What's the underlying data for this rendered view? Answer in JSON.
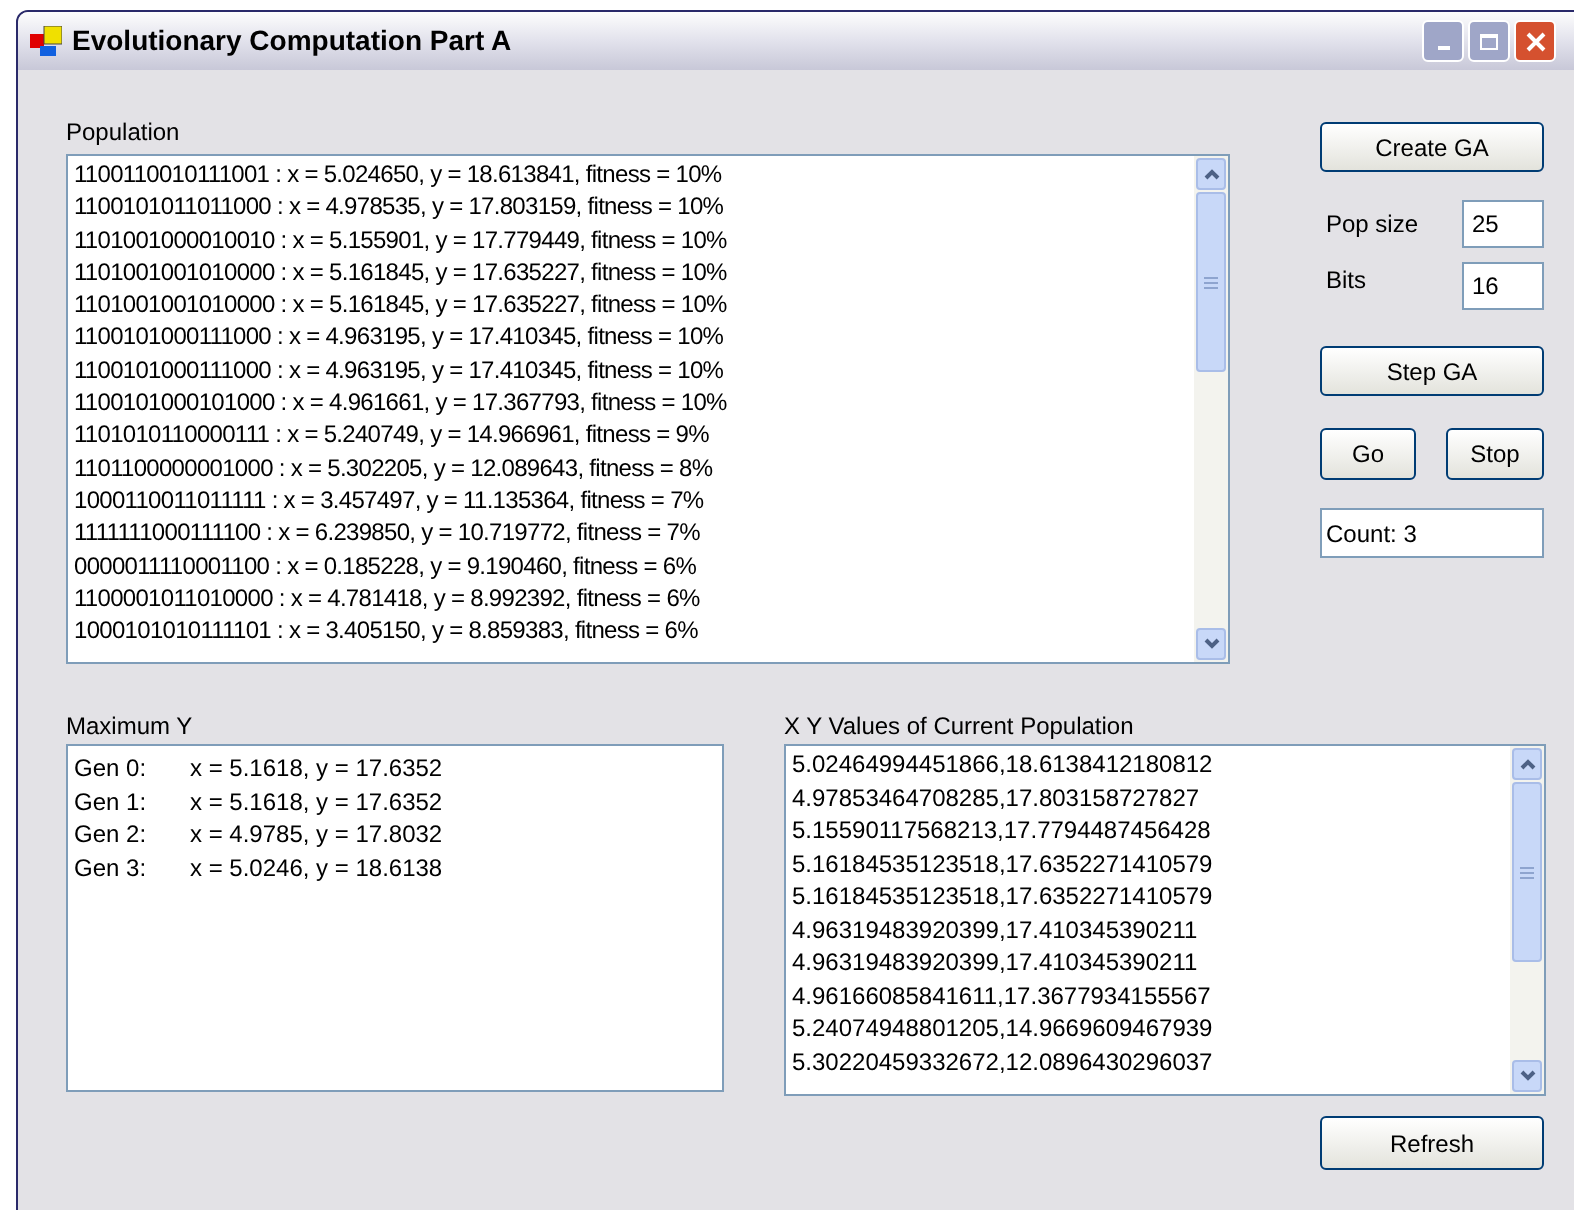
{
  "window": {
    "title": "Evolutionary Computation Part A"
  },
  "population": {
    "label": "Population",
    "items": [
      "1100110010111001 : x = 5.024650, y = 18.613841, fitness = 10%",
      "1100101011011000 : x = 4.978535, y = 17.803159, fitness = 10%",
      "1101001000010010 : x = 5.155901, y = 17.779449, fitness = 10%",
      "1101001001010000 : x = 5.161845, y = 17.635227, fitness = 10%",
      "1101001001010000 : x = 5.161845, y = 17.635227, fitness = 10%",
      "1100101000111000 : x = 4.963195, y = 17.410345, fitness = 10%",
      "1100101000111000 : x = 4.963195, y = 17.410345, fitness = 10%",
      "1100101000101000 : x = 4.961661, y = 17.367793, fitness = 10%",
      "1101010110000111 : x = 5.240749, y = 14.966961, fitness = 9%",
      "1101100000001000 : x = 5.302205, y = 12.089643, fitness = 8%",
      "1000110011011111 : x = 3.457497, y = 11.135364, fitness = 7%",
      "1111111000111100 : x = 6.239850, y = 10.719772, fitness = 7%",
      "0000011110001100 : x = 0.185228, y = 9.190460, fitness = 6%",
      "1100001011010000 : x = 4.781418, y = 8.992392, fitness = 6%",
      "1000101010111101 : x = 3.405150, y = 8.859383, fitness = 6%"
    ]
  },
  "controls": {
    "create_button": "Create GA",
    "pop_size_label": "Pop size",
    "pop_size_value": "25",
    "bits_label": "Bits",
    "bits_value": "16",
    "step_button": "Step GA",
    "go_button": "Go",
    "stop_button": "Stop",
    "count_value": "Count: 3"
  },
  "maximum_y": {
    "label": "Maximum Y",
    "rows": [
      {
        "gen": "Gen 0:",
        "values": "x = 5.1618, y = 17.6352"
      },
      {
        "gen": "Gen 1:",
        "values": "x = 5.1618, y = 17.6352"
      },
      {
        "gen": "Gen 2:",
        "values": "x = 4.9785, y = 17.8032"
      },
      {
        "gen": "Gen 3:",
        "values": "x = 5.0246, y = 18.6138"
      }
    ]
  },
  "xy_values": {
    "label": "X Y Values of Current Population",
    "items": [
      "5.02464994451866,18.6138412180812",
      "4.97853464708285,17.803158727827",
      "5.15590117568213,17.7794487456428",
      "5.16184535123518,17.6352271410579",
      "5.16184535123518,17.6352271410579",
      "4.96319483920399,17.410345390211",
      "4.96319483920399,17.410345390211",
      "4.96166085841611,17.3677934155567",
      "5.24074948801205,14.9669609467939",
      "5.30220459332672,12.0896430296037"
    ]
  },
  "refresh_button": "Refresh"
}
